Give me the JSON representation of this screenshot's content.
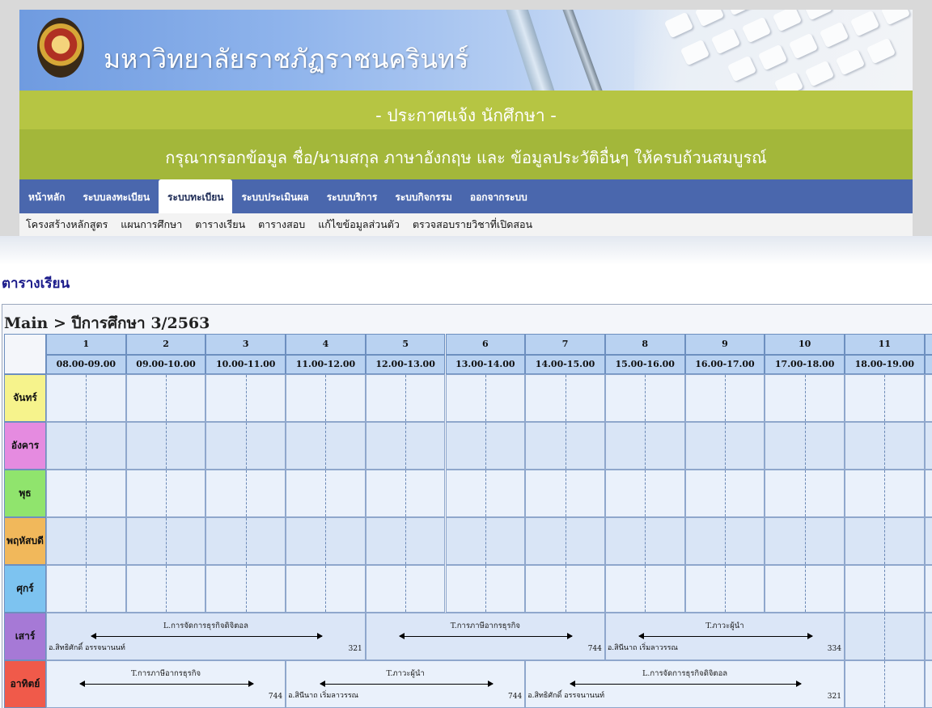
{
  "header": {
    "university_name": "มหาวิทยาลัยราชภัฏราชนครินทร์",
    "notice_title": "- ประกาศแจ้ง นักศึกษา -",
    "notice_body": "กรุณากรอกข้อมูล ชื่อ/นามสกุล ภาษาอังกฤษ และ ข้อมูลประวัติอื่นๆ ให้ครบถ้วนสมบูรณ์"
  },
  "main_nav": [
    {
      "label": "หน้าหลัก"
    },
    {
      "label": "ระบบลงทะเบียน"
    },
    {
      "label": "ระบบทะเบียน",
      "active": true
    },
    {
      "label": "ระบบประเมินผล"
    },
    {
      "label": "ระบบบริการ"
    },
    {
      "label": "ระบบกิจกรรม"
    },
    {
      "label": "ออกจากระบบ"
    }
  ],
  "sub_nav": [
    {
      "label": "โครงสร้างหลักสูตร"
    },
    {
      "label": "แผนการศึกษา"
    },
    {
      "label": "ตารางเรียน"
    },
    {
      "label": "ตารางสอบ"
    },
    {
      "label": "แก้ไขข้อมูลส่วนตัว"
    },
    {
      "label": "ตรวจสอบรายวิชาที่เปิดสอน"
    }
  ],
  "page": {
    "title": "ตารางเรียน",
    "caption": "Main > ปีการศึกษา 3/2563"
  },
  "timetable": {
    "periods": [
      {
        "no": "1",
        "time": "08.00-09.00"
      },
      {
        "no": "2",
        "time": "09.00-10.00"
      },
      {
        "no": "3",
        "time": "10.00-11.00"
      },
      {
        "no": "4",
        "time": "11.00-12.00"
      },
      {
        "no": "5",
        "time": "12.00-13.00"
      },
      {
        "no": "6",
        "time": "13.00-14.00"
      },
      {
        "no": "7",
        "time": "14.00-15.00"
      },
      {
        "no": "8",
        "time": "15.00-16.00"
      },
      {
        "no": "9",
        "time": "16.00-17.00"
      },
      {
        "no": "10",
        "time": "17.00-18.00"
      },
      {
        "no": "11",
        "time": "18.00-19.00"
      }
    ],
    "days": [
      {
        "label": "จันทร์",
        "color": "#f6f38c"
      },
      {
        "label": "อังคาร",
        "color": "#e58be0"
      },
      {
        "label": "พุธ",
        "color": "#90e46d"
      },
      {
        "label": "พฤหัสบดี",
        "color": "#f1b85b"
      },
      {
        "label": "ศุกร์",
        "color": "#7dc3f0"
      },
      {
        "label": "เสาร์",
        "color": "#a679d6"
      },
      {
        "label": "อาทิตย์",
        "color": "#f05a4a"
      }
    ],
    "courses": [
      {
        "day": 5,
        "start": 0,
        "span": 4,
        "name": "L.การจัดการธุรกิจดิจิตอล",
        "teacher": "อ.สิทธิศักดิ์ อรรจนานนท์",
        "room": "321"
      },
      {
        "day": 5,
        "start": 4,
        "span": 3,
        "name": "T.การภาษีอากรธุรกิจ",
        "teacher": "",
        "room": "744"
      },
      {
        "day": 5,
        "start": 7,
        "span": 3,
        "name": "T.ภาวะผู้นำ",
        "teacher": "อ.สินีนาถ เริ่มลาวรรณ",
        "room": "334"
      },
      {
        "day": 6,
        "start": 0,
        "span": 3,
        "name": "T.การภาษีอากรธุรกิจ",
        "teacher": "",
        "room": "744"
      },
      {
        "day": 6,
        "start": 3,
        "span": 3,
        "name": "T.ภาวะผู้นำ",
        "teacher": "อ.สินีนาถ เริ่มลาวรรณ",
        "room": "744"
      },
      {
        "day": 6,
        "start": 6,
        "span": 4,
        "name": "L.การจัดการธุรกิจดิจิตอล",
        "teacher": "อ.สิทธิศักดิ์ อรรจนานนท์",
        "room": "321"
      }
    ]
  }
}
